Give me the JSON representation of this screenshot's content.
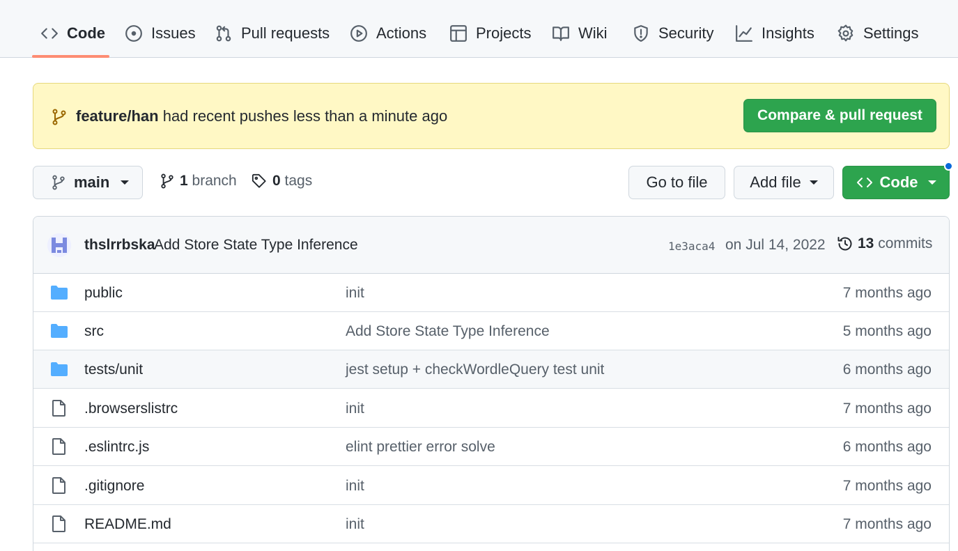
{
  "nav": {
    "tabs": [
      {
        "label": "Code",
        "icon": "code-icon"
      },
      {
        "label": "Issues",
        "icon": "issue-icon"
      },
      {
        "label": "Pull requests",
        "icon": "pull-request-icon"
      },
      {
        "label": "Actions",
        "icon": "play-icon"
      },
      {
        "label": "Projects",
        "icon": "table-icon"
      },
      {
        "label": "Wiki",
        "icon": "book-icon"
      },
      {
        "label": "Security",
        "icon": "shield-icon"
      },
      {
        "label": "Insights",
        "icon": "graph-icon"
      },
      {
        "label": "Settings",
        "icon": "gear-icon"
      }
    ]
  },
  "flash": {
    "branch": "feature/han",
    "message": " had recent pushes less than a minute ago",
    "button": "Compare & pull request"
  },
  "toolbar": {
    "branch_name": "main",
    "branch_count": "1",
    "branch_label": " branch",
    "tag_count": "0",
    "tag_label": " tags",
    "go_to_file": "Go to file",
    "add_file": "Add file",
    "code": "Code"
  },
  "commit": {
    "author": "thslrrbska",
    "message": "Add Store State Type Inference",
    "sha": "1e3aca4",
    "date": "on Jul 14, 2022",
    "count": "13",
    "count_label": " commits"
  },
  "files": [
    {
      "type": "folder",
      "name": "public",
      "message": "init",
      "age": "7 months ago"
    },
    {
      "type": "folder",
      "name": "src",
      "message": "Add Store State Type Inference",
      "age": "5 months ago"
    },
    {
      "type": "folder",
      "name": "tests/unit",
      "message": "jest setup + checkWordleQuery test unit",
      "age": "6 months ago"
    },
    {
      "type": "file",
      "name": ".browserslistrc",
      "message": "init",
      "age": "7 months ago"
    },
    {
      "type": "file",
      "name": ".eslintrc.js",
      "message": "elint prettier error solve",
      "age": "6 months ago"
    },
    {
      "type": "file",
      "name": ".gitignore",
      "message": "init",
      "age": "7 months ago"
    },
    {
      "type": "file",
      "name": "README.md",
      "message": "init",
      "age": "7 months ago"
    }
  ],
  "colors": {
    "primary_green": "#2da44e",
    "flash_bg": "#fff8c5",
    "folder_blue": "#54aeff",
    "tab_underline": "#fd8c73",
    "notification_blue": "#0969da"
  }
}
